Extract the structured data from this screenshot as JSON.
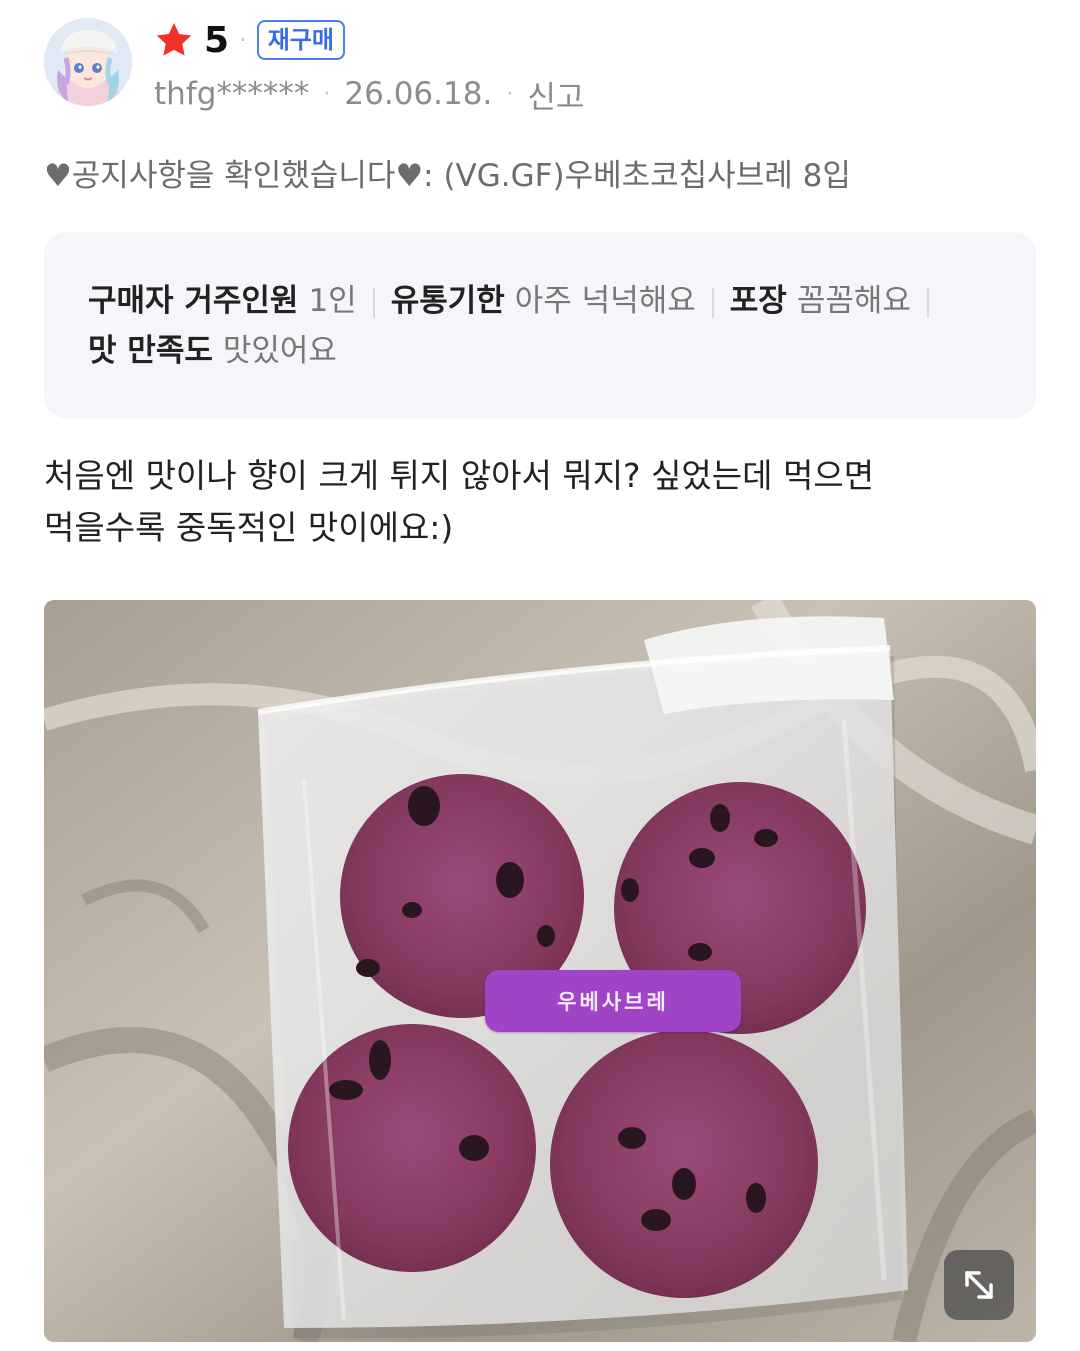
{
  "review": {
    "rating": "5",
    "badge": "재구매",
    "username": "thfg******",
    "date": "26.06.18.",
    "report_label": "신고",
    "option_text": "♥공지사항을 확인했습니다♥: (VG.GF)우베초코칩사브레 8입",
    "attributes": [
      {
        "key": "구매자 거주인원",
        "value": "1인"
      },
      {
        "key": "유통기한",
        "value": "아주 넉넉해요"
      },
      {
        "key": "포장",
        "value": "꼼꼼해요"
      },
      {
        "key": "맛 만족도",
        "value": "맛있어요"
      }
    ],
    "body_line1": "처음엔 맛이나 향이 크게 튀지 않아서 뭐지? 싶었는데 먹으면",
    "body_line2": "먹을수록 중독적인 맛이에요:)",
    "photo": {
      "sticker_label": "우베사브레",
      "icon": "expand-icon"
    }
  },
  "icons": {
    "star": "star-icon",
    "avatar": "avatar"
  },
  "colors": {
    "star": "#f2322a",
    "badge": "#3a6ae8",
    "summary_bg": "#f5f6f9",
    "sticker": "#a043c7",
    "cookie": "#8a3d6c"
  }
}
